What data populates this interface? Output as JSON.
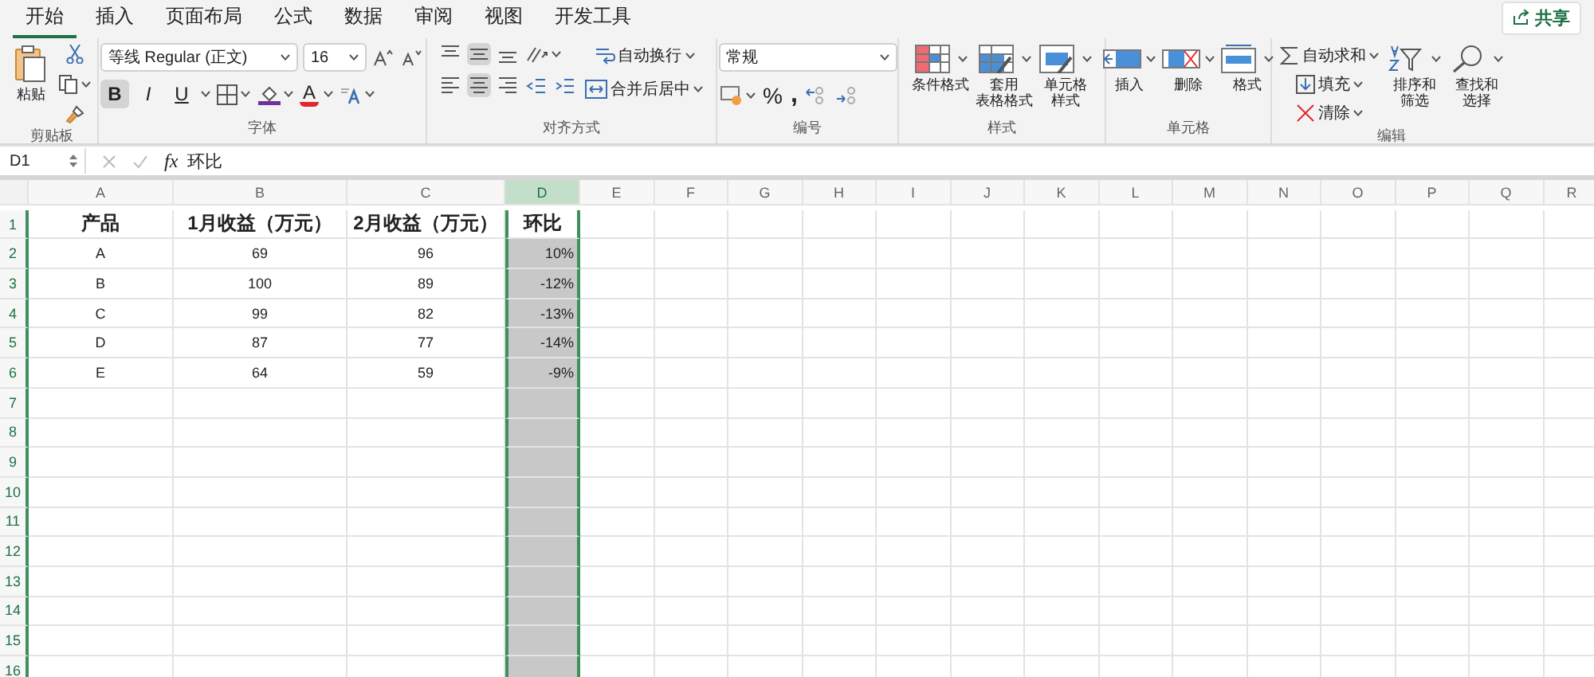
{
  "tabs": [
    {
      "label": "开始",
      "selected": true
    },
    {
      "label": "插入",
      "selected": false
    },
    {
      "label": "页面布局",
      "selected": false
    },
    {
      "label": "公式",
      "selected": false
    },
    {
      "label": "数据",
      "selected": false
    },
    {
      "label": "审阅",
      "selected": false
    },
    {
      "label": "视图",
      "selected": false
    },
    {
      "label": "开发工具",
      "selected": false
    }
  ],
  "share_button": "共享",
  "clipboard": {
    "paste": "粘贴",
    "label": "剪贴板"
  },
  "font": {
    "name": "等线 Regular (正文)",
    "size": "16",
    "style_buttons": [
      {
        "label": "B",
        "selected": true
      },
      {
        "label": "I",
        "selected": false
      },
      {
        "label": "U",
        "selected": false
      }
    ],
    "color_letter": "A",
    "label": "字体"
  },
  "alignment": {
    "vertical": [
      {
        "selected": false
      },
      {
        "selected": true
      },
      {
        "selected": false
      }
    ],
    "horizontal": [
      {
        "selected": false
      },
      {
        "selected": true
      },
      {
        "selected": false
      }
    ],
    "wrap": "自动换行",
    "merge": "合并后居中",
    "label": "对齐方式"
  },
  "number": {
    "format": "常规",
    "percent": "%",
    "comma": ",",
    "label": "编号"
  },
  "styles": {
    "buttons": [
      {
        "kind": "conditional",
        "lines": [
          "条件格式"
        ]
      },
      {
        "kind": "table",
        "lines": [
          "套用",
          "表格格式"
        ]
      },
      {
        "kind": "cell",
        "lines": [
          "单元格",
          "样式"
        ]
      }
    ],
    "label": "样式"
  },
  "cells": {
    "buttons": [
      {
        "kind": "insert",
        "lines": [
          "插入"
        ]
      },
      {
        "kind": "delete",
        "lines": [
          "删除"
        ]
      },
      {
        "kind": "format",
        "lines": [
          "格式"
        ]
      }
    ],
    "label": "单元格"
  },
  "editing": {
    "items": [
      {
        "kind": "sum",
        "label": "自动求和"
      },
      {
        "kind": "fill",
        "label": "填充"
      },
      {
        "kind": "clear",
        "label": "清除"
      }
    ],
    "buttons": [
      {
        "kind": "sort",
        "lines": [
          "排序和",
          "筛选"
        ]
      },
      {
        "kind": "find",
        "lines": [
          "查找和",
          "选择"
        ]
      }
    ],
    "label": "编辑"
  },
  "formula_bar": {
    "name_box": "D1",
    "fx": "fx",
    "content": "环比"
  },
  "columns": [
    {
      "letter": "A",
      "kind": "text",
      "selected": false
    },
    {
      "letter": "B",
      "kind": "text",
      "selected": false
    },
    {
      "letter": "C",
      "kind": "text",
      "selected": false
    },
    {
      "letter": "D",
      "kind": "percent",
      "selected": true
    },
    {
      "letter": "E",
      "selected": false
    },
    {
      "letter": "F",
      "selected": false
    },
    {
      "letter": "G",
      "selected": false
    },
    {
      "letter": "H",
      "selected": false
    },
    {
      "letter": "I",
      "selected": false
    },
    {
      "letter": "J",
      "selected": false
    },
    {
      "letter": "K",
      "selected": false
    },
    {
      "letter": "L",
      "selected": false
    },
    {
      "letter": "M",
      "selected": false
    },
    {
      "letter": "N",
      "selected": false
    },
    {
      "letter": "O",
      "selected": false
    },
    {
      "letter": "P",
      "selected": false
    },
    {
      "letter": "Q",
      "selected": false
    },
    {
      "letter": "R",
      "selected": false
    }
  ],
  "rows": [
    {
      "number": "1",
      "kind": "header",
      "active": true,
      "cells": [
        "产品",
        "1月收益（万元）",
        "2月收益（万元）",
        "环比"
      ]
    },
    {
      "number": "2",
      "active": false,
      "cells": [
        "A",
        "69",
        "96",
        "10%"
      ]
    },
    {
      "number": "3",
      "active": false,
      "cells": [
        "B",
        "100",
        "89",
        "-12%"
      ]
    },
    {
      "number": "4",
      "active": false,
      "cells": [
        "C",
        "99",
        "82",
        "-13%"
      ]
    },
    {
      "number": "5",
      "active": false,
      "cells": [
        "D",
        "87",
        "77",
        "-14%"
      ]
    },
    {
      "number": "6",
      "active": false,
      "cells": [
        "E",
        "64",
        "59",
        "-9%"
      ]
    },
    {
      "number": "7",
      "active": false,
      "cells": []
    },
    {
      "number": "8",
      "active": false,
      "cells": []
    },
    {
      "number": "9",
      "active": false,
      "cells": []
    },
    {
      "number": "10",
      "active": false,
      "cells": []
    },
    {
      "number": "11",
      "active": false,
      "cells": []
    },
    {
      "number": "12",
      "active": false,
      "cells": []
    },
    {
      "number": "13",
      "active": false,
      "cells": []
    },
    {
      "number": "14",
      "active": false,
      "cells": []
    },
    {
      "number": "15",
      "active": false,
      "cells": []
    },
    {
      "number": "16",
      "active": false,
      "cells": []
    }
  ]
}
